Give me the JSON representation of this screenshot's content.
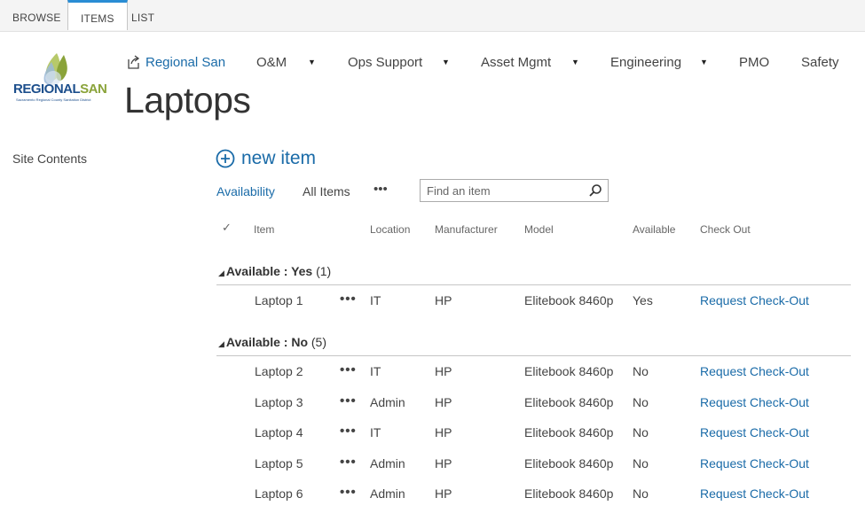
{
  "ribbon": {
    "tabs": [
      {
        "label": "BROWSE"
      },
      {
        "label": "ITEMS"
      },
      {
        "label": "LIST"
      }
    ]
  },
  "logo": {
    "text_a": "REGIONAL",
    "text_b": "SAN",
    "subtitle": "Sacramento Regional County Sanitation District"
  },
  "topnav": {
    "items": [
      {
        "label": "Regional San"
      },
      {
        "label": "O&M"
      },
      {
        "label": "Ops Support"
      },
      {
        "label": "Asset Mgmt"
      },
      {
        "label": "Engineering"
      },
      {
        "label": "PMO"
      },
      {
        "label": "Safety"
      }
    ]
  },
  "page": {
    "title": "Laptops"
  },
  "quicklaunch": {
    "site_contents": "Site Contents"
  },
  "toolbar": {
    "new_item": "new item",
    "views": [
      {
        "label": "Availability"
      },
      {
        "label": "All Items"
      }
    ],
    "more": "•••",
    "search_placeholder": "Find an item"
  },
  "table": {
    "check": "✓",
    "columns": [
      "Item",
      "Location",
      "Manufacturer",
      "Model",
      "Available",
      "Check Out"
    ],
    "groups": [
      {
        "field": "Available : ",
        "value": "Yes",
        "count": "(1)",
        "rows": [
          {
            "item": "Laptop 1",
            "location": "IT",
            "manufacturer": "HP",
            "model": "Elitebook 8460p",
            "available": "Yes",
            "checkout": "Request Check-Out"
          }
        ]
      },
      {
        "field": "Available : ",
        "value": "No",
        "count": "(5)",
        "rows": [
          {
            "item": "Laptop 2",
            "location": "IT",
            "manufacturer": "HP",
            "model": "Elitebook 8460p",
            "available": "No",
            "checkout": "Request Check-Out"
          },
          {
            "item": "Laptop 3",
            "location": "Admin",
            "manufacturer": "HP",
            "model": "Elitebook 8460p",
            "available": "No",
            "checkout": "Request Check-Out"
          },
          {
            "item": "Laptop 4",
            "location": "IT",
            "manufacturer": "HP",
            "model": "Elitebook 8460p",
            "available": "No",
            "checkout": "Request Check-Out"
          },
          {
            "item": "Laptop 5",
            "location": "Admin",
            "manufacturer": "HP",
            "model": "Elitebook 8460p",
            "available": "No",
            "checkout": "Request Check-Out"
          },
          {
            "item": "Laptop 6",
            "location": "Admin",
            "manufacturer": "HP",
            "model": "Elitebook 8460p",
            "available": "No",
            "checkout": "Request Check-Out"
          }
        ]
      }
    ],
    "row_menu": "•••"
  },
  "colors": {
    "link": "#1a6ba8",
    "ribbon_accent": "#2a8dd4",
    "logo_blue": "#1d4f8c",
    "logo_green": "#8aa33a"
  },
  "icons": [
    "home-share-icon",
    "caret-down-icon",
    "add-circle-icon",
    "search-icon",
    "checkmark-icon",
    "collapse-triangle-icon"
  ]
}
